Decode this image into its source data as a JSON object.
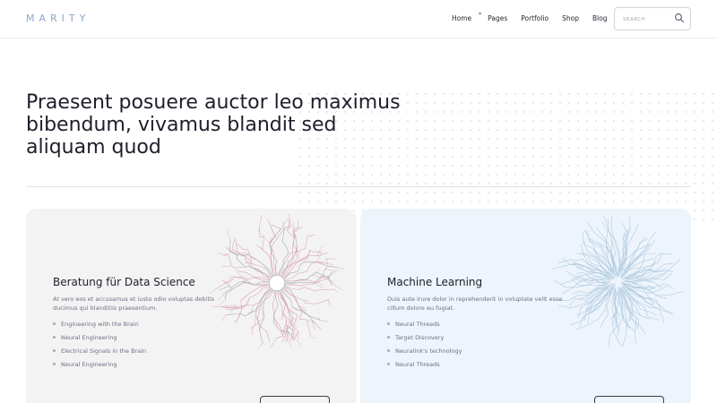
{
  "header": {
    "logo": "MARITY",
    "nav": [
      {
        "label": "Home"
      },
      {
        "label": "Pages",
        "marker": "*"
      },
      {
        "label": "Portfolio"
      },
      {
        "label": "Shop"
      },
      {
        "label": "Blog"
      }
    ],
    "search": {
      "placeholder": "SEARCH"
    }
  },
  "hero": {
    "headline": "Praesent posuere auctor leo maximus bibendum, vivamus blandit sed aliquam quod"
  },
  "cards": [
    {
      "title": "Beratung für Data Science",
      "description": "At vero eos et accusamus et iusto odio voluptas debitis ducimus qui blanditiis praesentium.",
      "items": [
        "Engineering with the Brain",
        "Neural Engineering",
        "Electrical Signals in the Brain",
        "Neural Engineering"
      ],
      "accent": "#d89aa2"
    },
    {
      "title": "Machine Learning",
      "description": "Duis aute irure dolor in reprehenderit in voluptate velit esse cillum dolore eu fugiat.",
      "items": [
        "Neural Threads",
        "Target Discovery",
        "Neuralink's technology",
        "Neural Threads"
      ],
      "accent": "#a9c6dd"
    }
  ]
}
